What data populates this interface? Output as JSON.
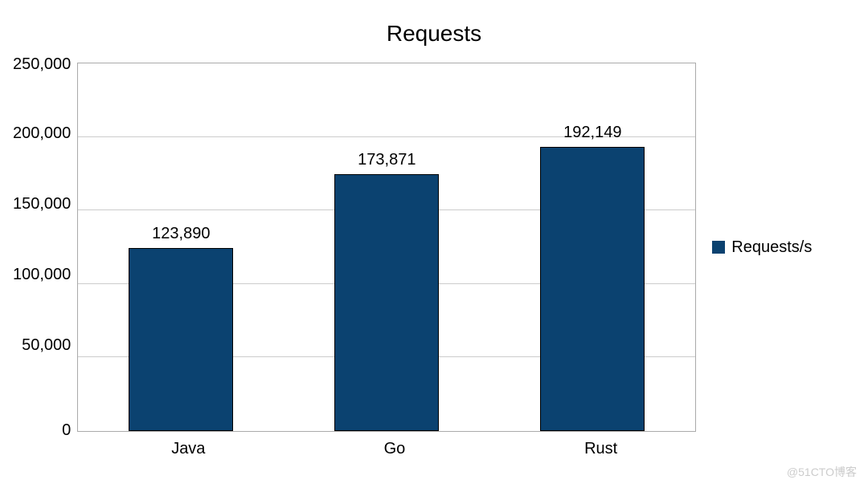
{
  "chart_data": {
    "type": "bar",
    "title": "Requests",
    "categories": [
      "Java",
      "Go",
      "Rust"
    ],
    "series": [
      {
        "name": "Requests/s",
        "values": [
          123890,
          173871,
          192149
        ],
        "labels": [
          "123,890",
          "173,871",
          "192,149"
        ]
      }
    ],
    "ylim": [
      0,
      250000
    ],
    "y_ticks": [
      "250,000",
      "200,000",
      "150,000",
      "100,000",
      "50,000",
      "0"
    ],
    "xlabel": "",
    "ylabel": ""
  },
  "legend": {
    "label": "Requests/s"
  },
  "watermark": "@51CTO博客",
  "colors": {
    "bar": "#0b4270"
  }
}
